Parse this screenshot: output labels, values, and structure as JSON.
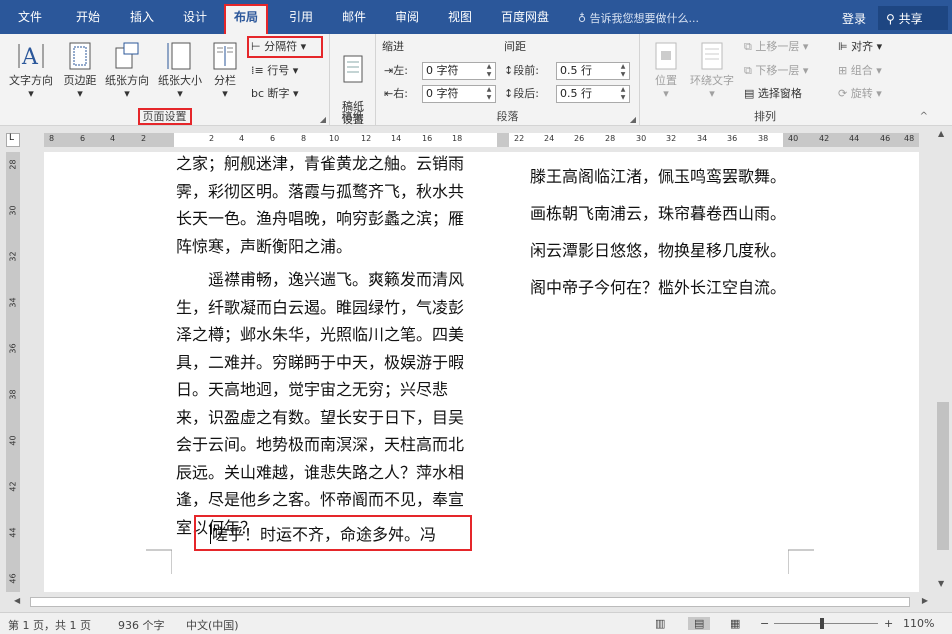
{
  "tabs": [
    "文件",
    "开始",
    "插入",
    "设计",
    "布局",
    "引用",
    "邮件",
    "审阅",
    "视图",
    "百度网盘"
  ],
  "tell_me": "告诉我您想要做什么...",
  "login": "登录",
  "share": "共享",
  "page_setup": {
    "label": "页面设置",
    "text_direction": "文字方向",
    "margins": "页边距",
    "orientation": "纸张方向",
    "size": "纸张大小",
    "columns": "分栏",
    "breaks": "分隔符",
    "line_numbers": "行号",
    "hyphenation": "断字"
  },
  "manuscript": {
    "label": "稿纸",
    "button": "稿纸\n设置"
  },
  "paragraph": {
    "label": "段落",
    "indent": "缩进",
    "spacing": "间距",
    "left": "左:",
    "right": "右:",
    "before": "段前:",
    "after": "段后:",
    "left_val": "0 字符",
    "right_val": "0 字符",
    "before_val": "0.5 行",
    "after_val": "0.5 行"
  },
  "arrange": {
    "label": "排列",
    "position": "位置",
    "wrap": "环绕文字",
    "bring_forward": "上移一层",
    "send_backward": "下移一层",
    "selection_pane": "选择窗格",
    "align": "对齐",
    "group": "组合",
    "rotate": "旋转"
  },
  "ruler": {
    "h_ticks": [
      "8",
      "6",
      "4",
      "2",
      "2",
      "4",
      "6",
      "8",
      "10",
      "12",
      "14",
      "16",
      "18",
      "22",
      "24",
      "26",
      "28",
      "30",
      "32",
      "34",
      "36",
      "38",
      "40",
      "42",
      "44",
      "46",
      "48"
    ],
    "v_ticks": [
      "28",
      "30",
      "32",
      "34",
      "36",
      "38",
      "40",
      "42",
      "44",
      "46"
    ]
  },
  "document": {
    "col1_p1": "之家；舸舰迷津，青雀黄龙之舳。云销雨霁，彩彻区明。落霞与孤鹜齐飞，秋水共长天一色。渔舟唱晚，响穷彭蠡之滨；雁阵惊寒，声断衡阳之浦。",
    "col1_p2": "遥襟甫畅，逸兴遄飞。爽籁发而清风生，纤歌凝而白云遏。睢园绿竹，气凌彭泽之樽；邺水朱华，光照临川之笔。四美具，二难并。穷睇眄于中天，极娱游于暇日。天高地迥，觉宇宙之无穷；兴尽悲来，识盈虚之有数。望长安于日下，目吴会于云间。地势极而南溟深，天柱高而北辰远。关山难越，谁悲失路之人？萍水相逢，尽是他乡之客。怀帝阍而不见，奉宣室以何年？",
    "col1_p3": "嗟乎！时运不齐，命途多舛。冯",
    "col2_lines": [
      "滕王高阁临江渚，佩玉鸣鸾罢歌舞。",
      "画栋朝飞南浦云，珠帘暮卷西山雨。",
      "闲云潭影日悠悠，物换星移几度秋。",
      "阁中帝子今何在？槛外长江空自流。"
    ]
  },
  "status": {
    "page": "第 1 页，共 1 页",
    "words": "936 个字",
    "language": "中文(中国)",
    "zoom": "110%"
  },
  "colors": {
    "brand": "#2b579a",
    "highlight": "#e5262a"
  }
}
